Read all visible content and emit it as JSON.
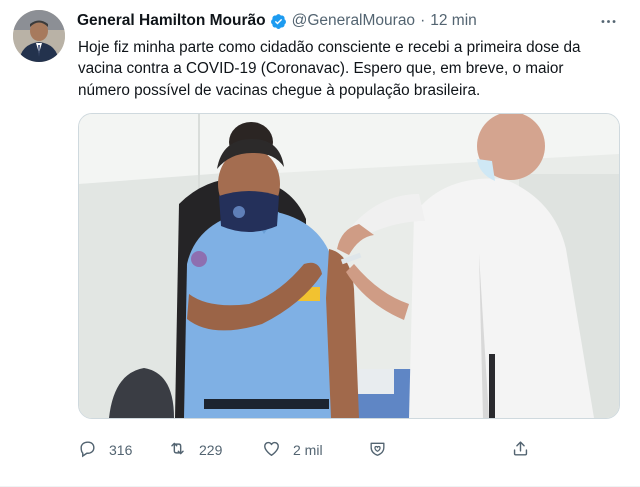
{
  "tweet": {
    "display_name": "General Hamilton Mourão",
    "handle": "@GeneralMourao",
    "separator": "·",
    "time": "12 min",
    "text": "Hoje fiz minha parte como cidadão consciente e recebi a primeira dose da\nvacina contra a COVID-19 (Coronavac). Espero que, em breve, o maior\nnúmero possível de vacinas chegue à população brasileira.",
    "verified": true
  },
  "actions": {
    "reply_count": "316",
    "retweet_count": "229",
    "like_count": "2 mil"
  },
  "icons": [
    "verified-badge-icon",
    "more-icon",
    "reply-icon",
    "retweet-icon",
    "like-icon",
    "heart-shield-icon",
    "share-icon"
  ],
  "colors": {
    "verified_blue": "#1d9bf0",
    "secondary_text": "#536471",
    "primary_text": "#0f1419"
  }
}
